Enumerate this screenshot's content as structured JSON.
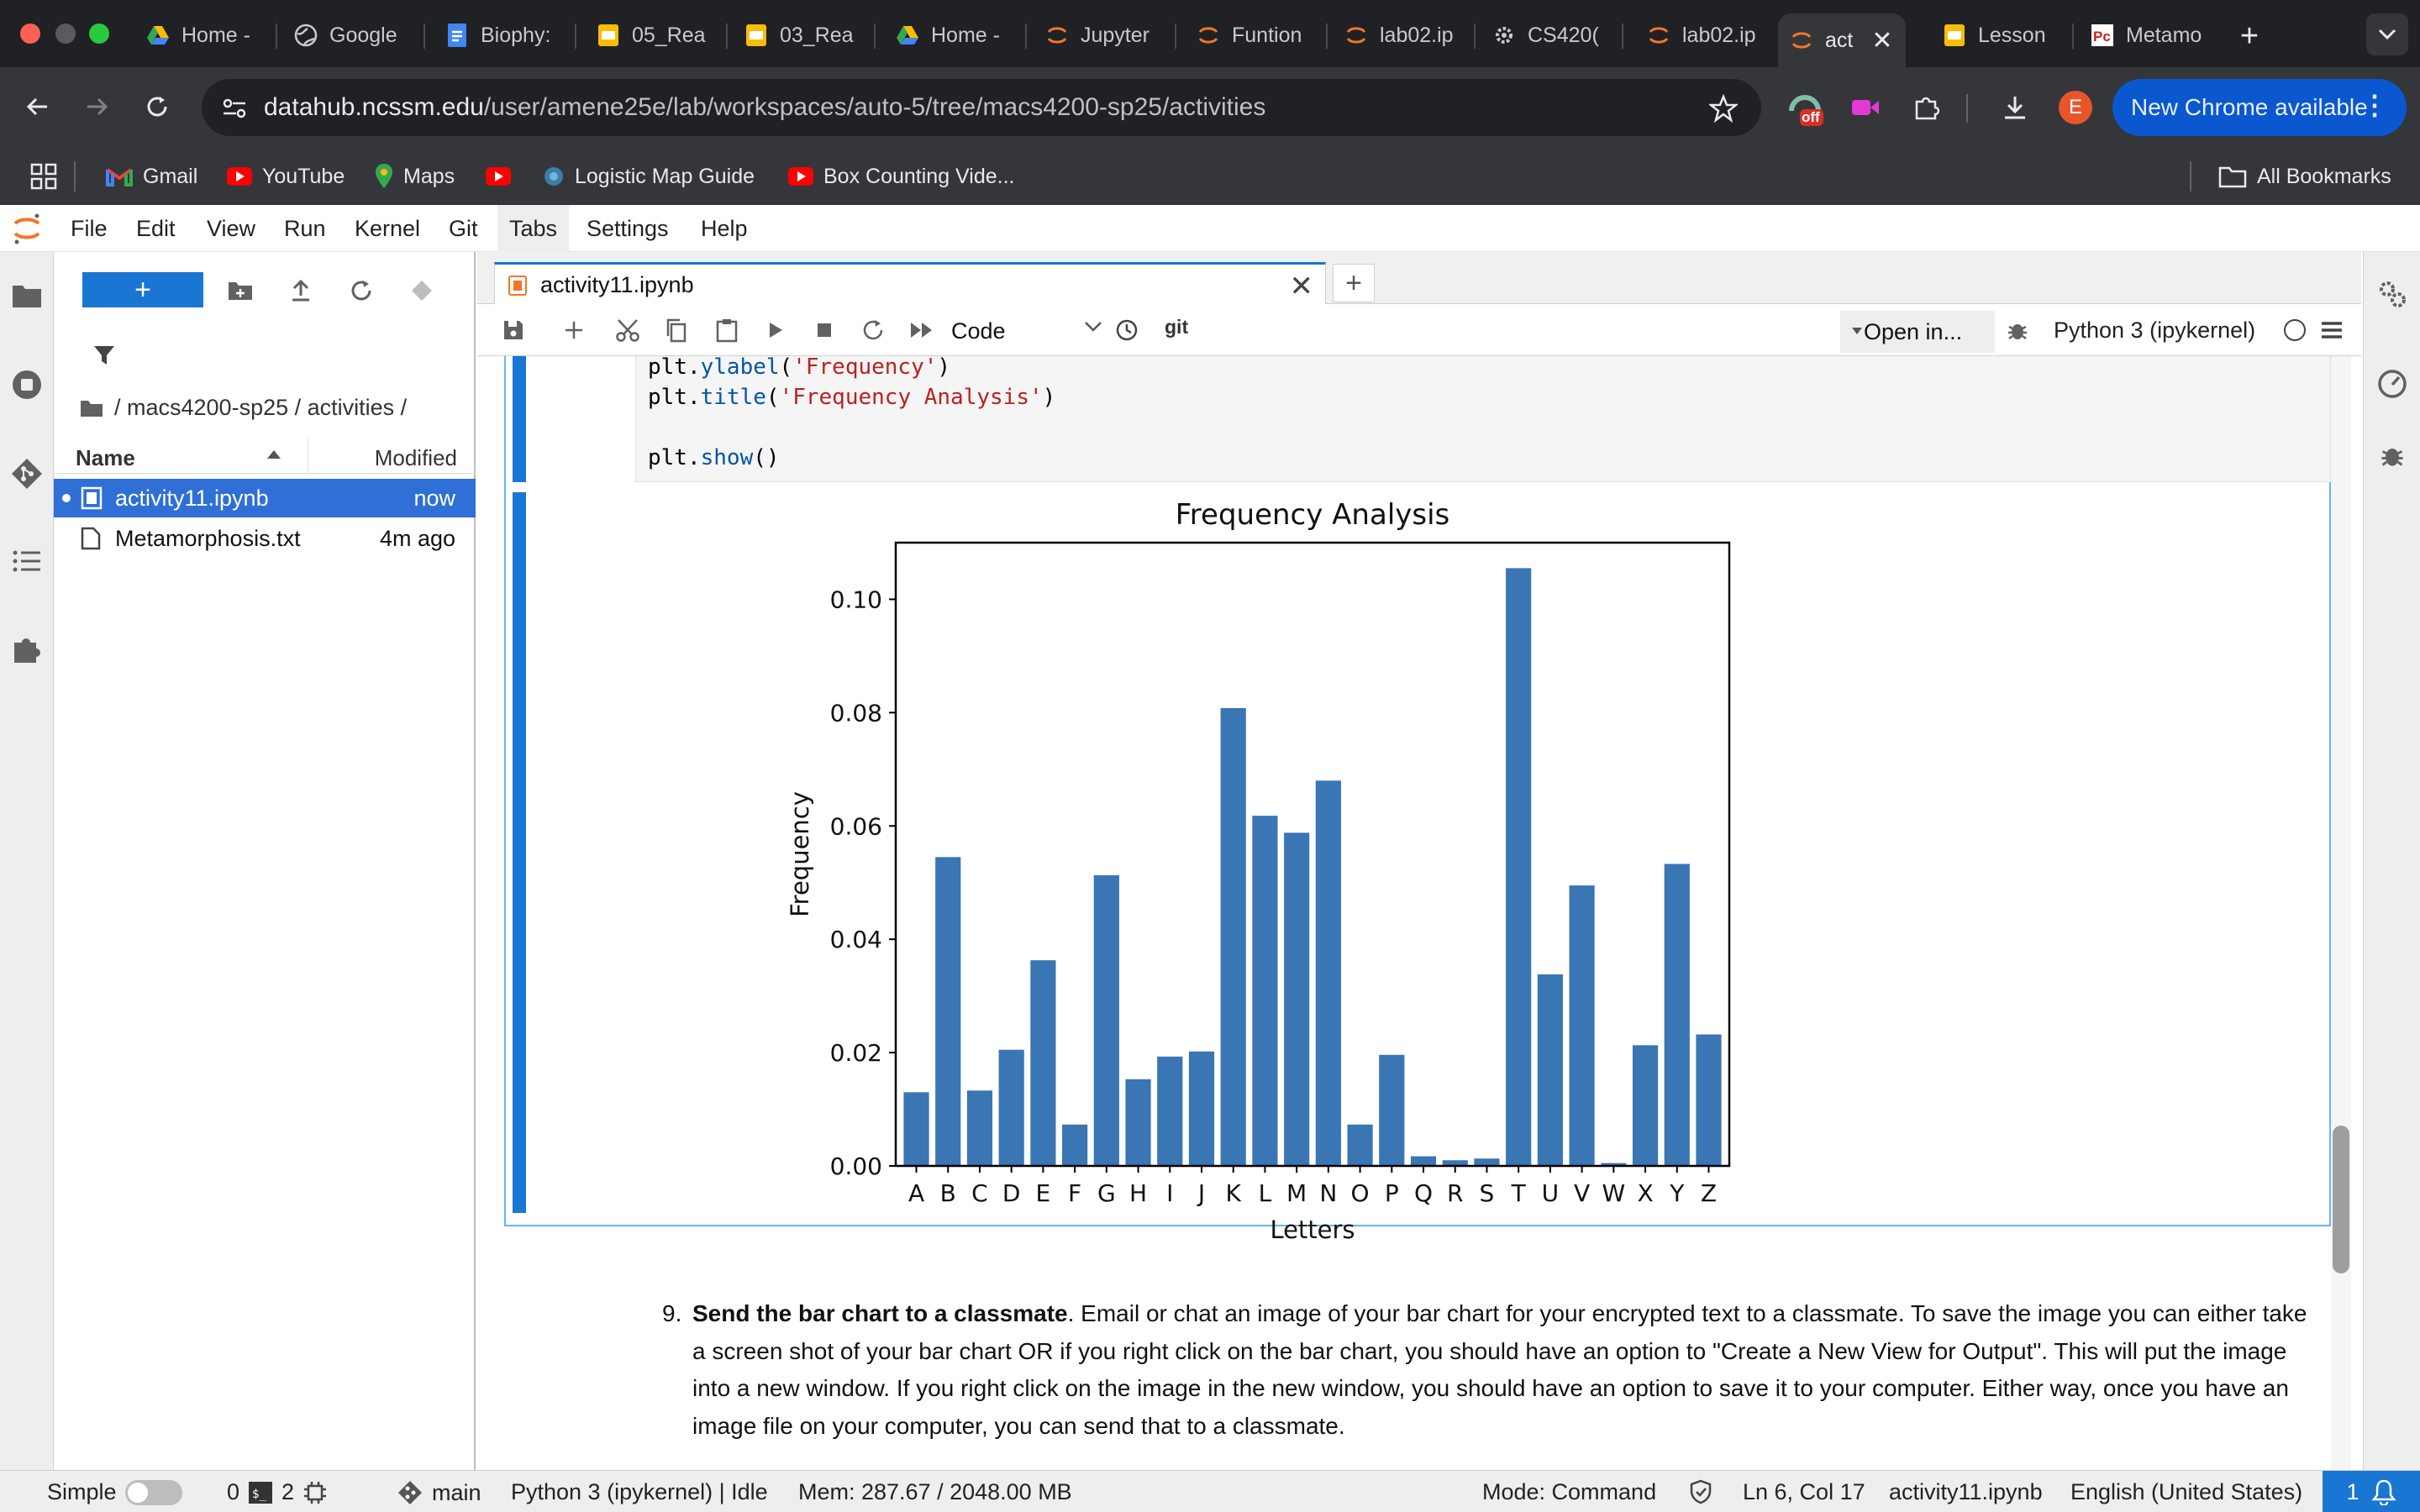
{
  "browser": {
    "tabs": [
      {
        "label": "Home -",
        "icon": "google-drive-icon"
      },
      {
        "label": "Google",
        "icon": "globe-icon"
      },
      {
        "label": "Biophy:",
        "icon": "google-docs-icon"
      },
      {
        "label": "05_Rea",
        "icon": "google-slides-icon"
      },
      {
        "label": "03_Rea",
        "icon": "google-slides-icon"
      },
      {
        "label": "Home -",
        "icon": "google-drive-icon"
      },
      {
        "label": "Jupyter",
        "icon": "jupyter-icon"
      },
      {
        "label": "Funtion",
        "icon": "jupyter-icon"
      },
      {
        "label": "lab02.ip",
        "icon": "jupyter-icon"
      },
      {
        "label": "CS420(",
        "icon": "gear-icon"
      },
      {
        "label": "lab02.ip",
        "icon": "jupyter-icon"
      },
      {
        "label": "act",
        "icon": "jupyter-icon",
        "active": true
      },
      {
        "label": "Lesson",
        "icon": "google-slides-icon"
      },
      {
        "label": "Metamo",
        "icon": "pdf-icon"
      }
    ],
    "url_host": "datahub.ncssm.edu",
    "url_path": "/user/amene25e/lab/workspaces/auto-5/tree/macs4200-sp25/activities",
    "extension_badge": "off",
    "profile_initial": "E",
    "update_label": "New Chrome available",
    "bookmarks": [
      {
        "label": "Gmail",
        "icon": "gmail-icon"
      },
      {
        "label": "YouTube",
        "icon": "youtube-icon"
      },
      {
        "label": "Maps",
        "icon": "maps-icon"
      },
      {
        "label": "",
        "icon": "youtube-icon"
      },
      {
        "label": "Logistic Map Guide",
        "icon": "globe-icon"
      },
      {
        "label": "Box Counting Vide...",
        "icon": "youtube-icon"
      }
    ],
    "all_bookmarks_label": "All Bookmarks"
  },
  "menubar": [
    "File",
    "Edit",
    "View",
    "Run",
    "Kernel",
    "Git",
    "Tabs",
    "Settings",
    "Help"
  ],
  "filebrowser": {
    "new_button": "+",
    "breadcrumb": "/ macs4200-sp25 / activities /",
    "col_name": "Name",
    "col_modified": "Modified",
    "files": [
      {
        "name": "activity11.ipynb",
        "modified": "now",
        "selected": true
      },
      {
        "name": "Metamorphosis.txt",
        "modified": "4m ago",
        "selected": false
      }
    ]
  },
  "notebook": {
    "tab_title": "activity11.ipynb",
    "cell_type": "Code",
    "git_label": "git",
    "open_in": "Open in...",
    "kernel": "Python 3 (ipykernel)",
    "code_lines": [
      [
        "plt.",
        "ylabel",
        "(",
        "'Frequency'",
        ")"
      ],
      [
        "plt.",
        "title",
        "(",
        "'Frequency Analysis'",
        ")"
      ],
      [
        "",
        "",
        "",
        "",
        ""
      ],
      [
        "plt.",
        "show",
        "()",
        "",
        ""
      ]
    ],
    "markdown": {
      "number": "9.",
      "bold": "Send the bar chart to a classmate",
      "text": ". Email or chat an image of your bar chart for your encrypted text to a classmate. To save the image you can either take a screen shot of your bar chart OR if you right click on the bar chart, you should have an option to \"Create a New View for Output\". This will put the image into a new window. If you right click on the image in the new window, you should have an option to save it to your computer. Either way, once you have an image file on your computer, you can send that to a classmate."
    }
  },
  "chart_data": {
    "type": "bar",
    "title": "Frequency Analysis",
    "xlabel": "Letters",
    "ylabel": "Frequency",
    "categories": [
      "A",
      "B",
      "C",
      "D",
      "E",
      "F",
      "G",
      "H",
      "I",
      "J",
      "K",
      "L",
      "M",
      "N",
      "O",
      "P",
      "Q",
      "R",
      "S",
      "T",
      "U",
      "V",
      "W",
      "X",
      "Y",
      "Z"
    ],
    "values": [
      0.013,
      0.0545,
      0.0133,
      0.0205,
      0.0363,
      0.0073,
      0.0513,
      0.0153,
      0.0193,
      0.0202,
      0.0808,
      0.0618,
      0.0588,
      0.068,
      0.0073,
      0.0196,
      0.0017,
      0.001,
      0.0013,
      0.1055,
      0.0338,
      0.0495,
      0.0005,
      0.0213,
      0.0533,
      0.0232
    ],
    "yticks": [
      "0.00",
      "0.02",
      "0.04",
      "0.06",
      "0.08",
      "0.10"
    ],
    "ylim": [
      0,
      0.11
    ],
    "bar_color": "#3a75b4",
    "grid": false
  },
  "statusbar": {
    "mode_label": "Simple",
    "terminals": "0",
    "kernels": "2",
    "branch": "main",
    "kernel_status": "Python 3 (ipykernel) | Idle",
    "memory": "Mem: 287.67 / 2048.00 MB",
    "command_mode": "Mode: Command",
    "cursor": "Ln 6, Col 17",
    "file": "activity11.ipynb",
    "language": "English (United States)",
    "notifications": "1"
  },
  "colors": {
    "jupyter_blue": "#1976d2",
    "jupyter_orange": "#f37626",
    "chrome_dark": "#202124"
  }
}
